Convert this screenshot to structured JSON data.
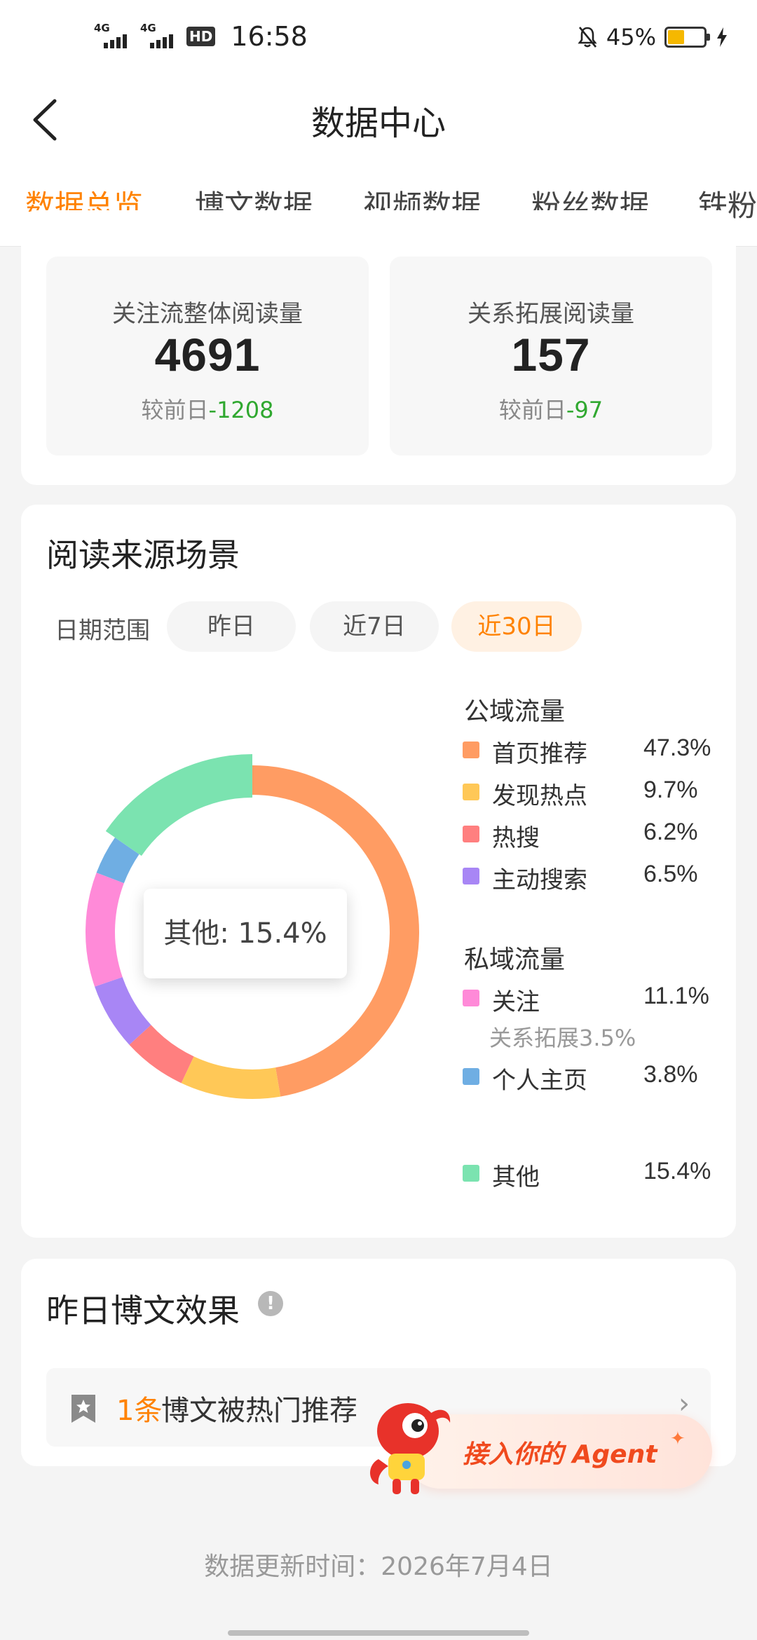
{
  "status_bar": {
    "network_1": "4G",
    "network_2": "4G",
    "hd_label": "HD",
    "time": "16:58",
    "battery_pct": "45%",
    "battery_level": 0.45,
    "icons": [
      "mute-bell-icon",
      "battery-icon",
      "charging-bolt-icon"
    ]
  },
  "header": {
    "title": "数据中心",
    "back_icon": "chevron-left-icon"
  },
  "tabs": [
    {
      "label": "数据总览",
      "active": true
    },
    {
      "label": "博文数据",
      "active": false
    },
    {
      "label": "视频数据",
      "active": false
    },
    {
      "label": "粉丝数据",
      "active": false
    },
    {
      "label": "铁粉",
      "active": false
    }
  ],
  "stats": [
    {
      "label": "关注流整体阅读量",
      "value": "4691",
      "delta_prefix": "较前日",
      "delta": "-1208"
    },
    {
      "label": "关系拓展阅读量",
      "value": "157",
      "delta_prefix": "较前日",
      "delta": "-97"
    }
  ],
  "read_source": {
    "title": "阅读来源场景",
    "range_label": "日期范围",
    "ranges": [
      {
        "label": "昨日",
        "active": false
      },
      {
        "label": "近7日",
        "active": false
      },
      {
        "label": "近30日",
        "active": true
      }
    ],
    "tooltip": "其他: 15.4%",
    "public_title": "公域流量",
    "private_title": "私域流量",
    "public_items": [
      {
        "name": "首页推荐",
        "pct": "47.3%",
        "color": "#FF9C63"
      },
      {
        "name": "发现热点",
        "pct": "9.7%",
        "color": "#FFC857"
      },
      {
        "name": "热搜",
        "pct": "6.2%",
        "color": "#FF7F7F"
      },
      {
        "name": "主动搜索",
        "pct": "6.5%",
        "color": "#A886F5"
      }
    ],
    "private_items": [
      {
        "name": "关注",
        "pct": "11.1%",
        "color": "#FF8AD8"
      },
      {
        "name": "个人主页",
        "pct": "3.8%",
        "color": "#6FAEE3"
      }
    ],
    "private_sub": "关系拓展3.5%",
    "other_item": {
      "name": "其他",
      "pct": "15.4%",
      "color": "#7BE3B0"
    }
  },
  "chart_data": {
    "type": "pie",
    "categories": [
      "首页推荐",
      "发现热点",
      "热搜",
      "主动搜索",
      "关注",
      "个人主页",
      "其他"
    ],
    "values": [
      47.3,
      9.7,
      6.2,
      6.5,
      11.1,
      3.8,
      15.4
    ],
    "colors": [
      "#FF9C63",
      "#FFC857",
      "#FF7F7F",
      "#A886F5",
      "#FF8AD8",
      "#6FAEE3",
      "#7BE3B0"
    ],
    "highlighted": "其他",
    "title": ""
  },
  "yesterday": {
    "title": "昨日博文效果",
    "info_icon": "info-icon",
    "hot_count": "1条",
    "hot_text": "博文被热门推荐",
    "chevron": "›"
  },
  "agent": {
    "label": "接入你的 Agent",
    "spark": "✦"
  },
  "footer": {
    "update_text": "数据更新时间：2026年7月4日"
  }
}
